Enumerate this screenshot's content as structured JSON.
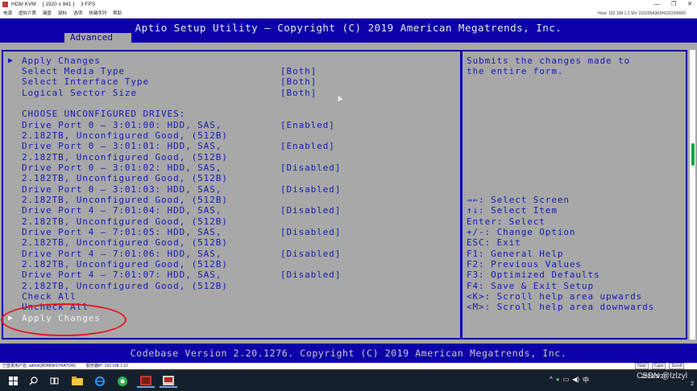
{
  "kvm": {
    "title": "HDM KVM",
    "resolution": "[ 1920 x 941 ]",
    "fps": "3 FPS",
    "menus": [
      "电源",
      "虚拟介质",
      "键盘",
      "鼠标",
      "选项",
      "热键序列",
      "帮助"
    ],
    "connection": "Host: 192.168.1.2    SN: 210235A3K0H19C000000",
    "window_buttons": [
      "—",
      "❐",
      "✕"
    ]
  },
  "bios": {
    "title": "Aptio Setup Utility – Copyright (C) 2019 American Megatrends, Inc.",
    "tab": "Advanced",
    "apply_changes_top": "Apply Changes",
    "settings": [
      {
        "label": "Select Media Type",
        "value": "[Both]"
      },
      {
        "label": "Select Interface Type",
        "value": "[Both]"
      },
      {
        "label": "Logical Sector Size",
        "value": "[Both]"
      }
    ],
    "drives_header": "CHOOSE UNCONFIGURED DRIVES:",
    "drives": [
      {
        "line1": "Drive Port 0 – 3:01:00: HDD, SAS,",
        "line2": "2.182TB, Unconfigured Good, (512B)",
        "value": "[Enabled]"
      },
      {
        "line1": "Drive Port 0 – 3:01:01: HDD, SAS,",
        "line2": "2.182TB, Unconfigured Good, (512B)",
        "value": "[Enabled]"
      },
      {
        "line1": "Drive Port 0 – 3:01:02: HDD, SAS,",
        "line2": "2.182TB, Unconfigured Good, (512B)",
        "value": "[Disabled]"
      },
      {
        "line1": "Drive Port 0 – 3:01:03: HDD, SAS,",
        "line2": "2.182TB, Unconfigured Good, (512B)",
        "value": "[Disabled]"
      },
      {
        "line1": "Drive Port 4 – 7:01:04: HDD, SAS,",
        "line2": "2.182TB, Unconfigured Good, (512B)",
        "value": "[Disabled]"
      },
      {
        "line1": "Drive Port 4 – 7:01:05: HDD, SAS,",
        "line2": "2.182TB, Unconfigured Good, (512B)",
        "value": "[Disabled]"
      },
      {
        "line1": "Drive Port 4 – 7:01:06: HDD, SAS,",
        "line2": "2.182TB, Unconfigured Good, (512B)",
        "value": "[Disabled]"
      },
      {
        "line1": "Drive Port 4 – 7:01:07: HDD, SAS,",
        "line2": "2.182TB, Unconfigured Good, (512B)",
        "value": "[Disabled]"
      }
    ],
    "check_all": "Check All",
    "uncheck_all": "Uncheck All",
    "apply_changes_bottom": "Apply Changes",
    "help_description": [
      "Submits the changes made to",
      "the entire form."
    ],
    "key_help": [
      "→←: Select Screen",
      "↑↓: Select Item",
      "Enter: Select",
      "+/-: Change Option",
      "ESC: Exit",
      "F1: General Help",
      "F2: Previous Values",
      "F3: Optimized Defaults",
      "F4: Save & Exit Setup",
      "<K>: Scroll help area upwards",
      "<M>: Scroll help area downwards"
    ],
    "footer": "Codebase Version 2.20.1276. Copyright (C) 2019 American Megatrends, Inc."
  },
  "statusbar": {
    "user": "已登录用户名: admin(ADMINISTRATOR)",
    "ip": "服务器IP: 192.168.1.10",
    "indicators": [
      "Num",
      "Caps",
      "Scroll"
    ]
  },
  "taskbar": {
    "time": "",
    "date": "2020/5/27",
    "ime": "中",
    "watermark": "CSDN @lzlzyl",
    "notification_count": "2"
  },
  "colors": {
    "bios_blue": "#0d00a8",
    "bios_gray": "#a8a8a8",
    "highlight_red": "#e8141e"
  }
}
